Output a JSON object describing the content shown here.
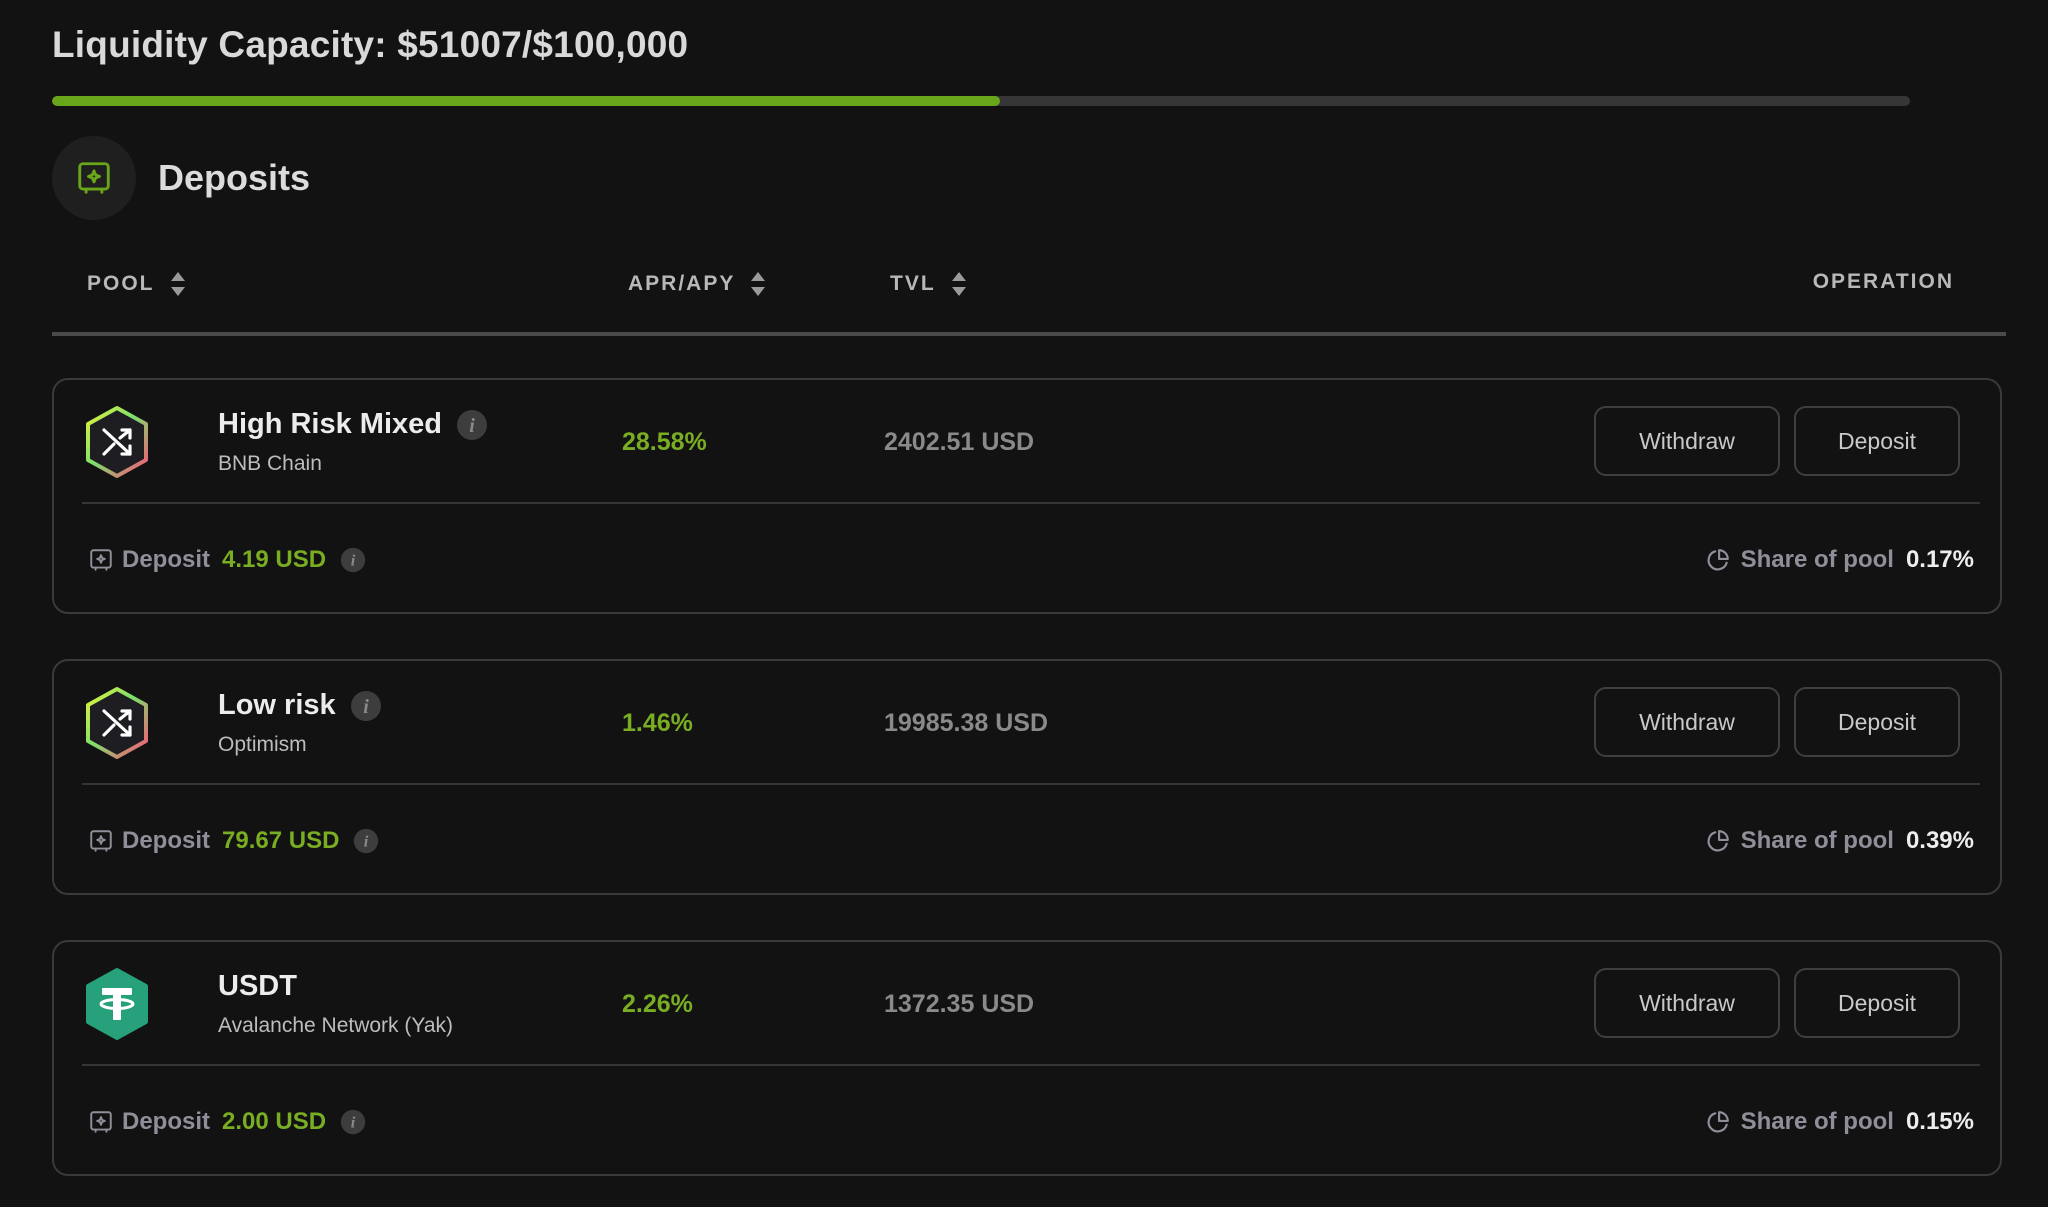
{
  "capacity": {
    "title": "Liquidity Capacity: $51007/$100,000",
    "current": 51007,
    "max": 100000,
    "fill_fraction": 0.51007
  },
  "colors": {
    "accent_green": "#6aa61a",
    "background": "#121212",
    "tether_green": "#26a17b"
  },
  "section": {
    "title": "Deposits",
    "icon": "safe-icon"
  },
  "table": {
    "headers": {
      "pool": "POOL",
      "apr": "APR/APY",
      "tvl": "TVL",
      "operation": "OPERATION"
    }
  },
  "pools": [
    {
      "name": "High Risk Mixed",
      "chain": "BNB Chain",
      "apr": "28.58%",
      "tvl": "2402.51 USD",
      "logo": "shuffle-hexagon-icon",
      "withdraw_label": "Withdraw",
      "deposit_label": "Deposit",
      "deposit_text": "Deposit",
      "deposit_amount": "4.19 USD",
      "share_label": "Share of pool",
      "share_value": "0.17%"
    },
    {
      "name": "Low risk",
      "chain": "Optimism",
      "apr": "1.46%",
      "tvl": "19985.38 USD",
      "logo": "shuffle-hexagon-icon",
      "withdraw_label": "Withdraw",
      "deposit_label": "Deposit",
      "deposit_text": "Deposit",
      "deposit_amount": "79.67 USD",
      "share_label": "Share of pool",
      "share_value": "0.39%"
    },
    {
      "name": "USDT",
      "chain": "Avalanche Network (Yak)",
      "apr": "2.26%",
      "tvl": "1372.35 USD",
      "logo": "tether-icon",
      "withdraw_label": "Withdraw",
      "deposit_label": "Deposit",
      "deposit_text": "Deposit",
      "deposit_amount": "2.00 USD",
      "share_label": "Share of pool",
      "share_value": "0.15%"
    }
  ]
}
